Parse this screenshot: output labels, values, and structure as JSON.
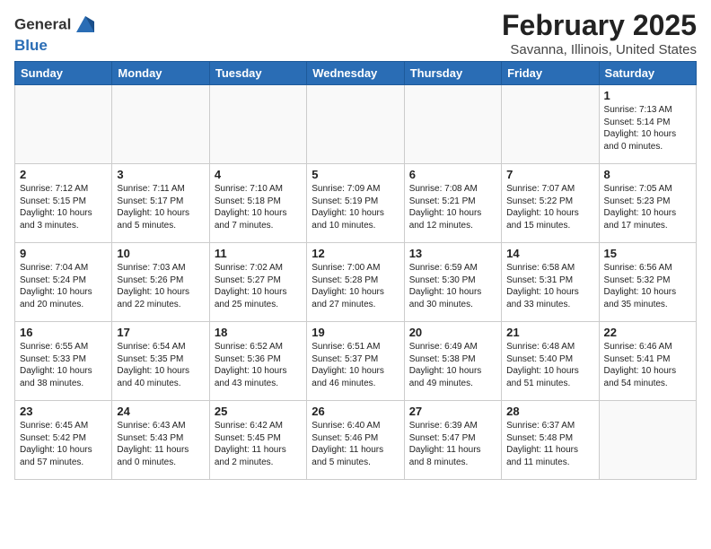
{
  "header": {
    "logo_line1": "General",
    "logo_line2": "Blue",
    "title": "February 2025",
    "subtitle": "Savanna, Illinois, United States"
  },
  "weekdays": [
    "Sunday",
    "Monday",
    "Tuesday",
    "Wednesday",
    "Thursday",
    "Friday",
    "Saturday"
  ],
  "weeks": [
    [
      {
        "day": "",
        "info": ""
      },
      {
        "day": "",
        "info": ""
      },
      {
        "day": "",
        "info": ""
      },
      {
        "day": "",
        "info": ""
      },
      {
        "day": "",
        "info": ""
      },
      {
        "day": "",
        "info": ""
      },
      {
        "day": "1",
        "info": "Sunrise: 7:13 AM\nSunset: 5:14 PM\nDaylight: 10 hours\nand 0 minutes."
      }
    ],
    [
      {
        "day": "2",
        "info": "Sunrise: 7:12 AM\nSunset: 5:15 PM\nDaylight: 10 hours\nand 3 minutes."
      },
      {
        "day": "3",
        "info": "Sunrise: 7:11 AM\nSunset: 5:17 PM\nDaylight: 10 hours\nand 5 minutes."
      },
      {
        "day": "4",
        "info": "Sunrise: 7:10 AM\nSunset: 5:18 PM\nDaylight: 10 hours\nand 7 minutes."
      },
      {
        "day": "5",
        "info": "Sunrise: 7:09 AM\nSunset: 5:19 PM\nDaylight: 10 hours\nand 10 minutes."
      },
      {
        "day": "6",
        "info": "Sunrise: 7:08 AM\nSunset: 5:21 PM\nDaylight: 10 hours\nand 12 minutes."
      },
      {
        "day": "7",
        "info": "Sunrise: 7:07 AM\nSunset: 5:22 PM\nDaylight: 10 hours\nand 15 minutes."
      },
      {
        "day": "8",
        "info": "Sunrise: 7:05 AM\nSunset: 5:23 PM\nDaylight: 10 hours\nand 17 minutes."
      }
    ],
    [
      {
        "day": "9",
        "info": "Sunrise: 7:04 AM\nSunset: 5:24 PM\nDaylight: 10 hours\nand 20 minutes."
      },
      {
        "day": "10",
        "info": "Sunrise: 7:03 AM\nSunset: 5:26 PM\nDaylight: 10 hours\nand 22 minutes."
      },
      {
        "day": "11",
        "info": "Sunrise: 7:02 AM\nSunset: 5:27 PM\nDaylight: 10 hours\nand 25 minutes."
      },
      {
        "day": "12",
        "info": "Sunrise: 7:00 AM\nSunset: 5:28 PM\nDaylight: 10 hours\nand 27 minutes."
      },
      {
        "day": "13",
        "info": "Sunrise: 6:59 AM\nSunset: 5:30 PM\nDaylight: 10 hours\nand 30 minutes."
      },
      {
        "day": "14",
        "info": "Sunrise: 6:58 AM\nSunset: 5:31 PM\nDaylight: 10 hours\nand 33 minutes."
      },
      {
        "day": "15",
        "info": "Sunrise: 6:56 AM\nSunset: 5:32 PM\nDaylight: 10 hours\nand 35 minutes."
      }
    ],
    [
      {
        "day": "16",
        "info": "Sunrise: 6:55 AM\nSunset: 5:33 PM\nDaylight: 10 hours\nand 38 minutes."
      },
      {
        "day": "17",
        "info": "Sunrise: 6:54 AM\nSunset: 5:35 PM\nDaylight: 10 hours\nand 40 minutes."
      },
      {
        "day": "18",
        "info": "Sunrise: 6:52 AM\nSunset: 5:36 PM\nDaylight: 10 hours\nand 43 minutes."
      },
      {
        "day": "19",
        "info": "Sunrise: 6:51 AM\nSunset: 5:37 PM\nDaylight: 10 hours\nand 46 minutes."
      },
      {
        "day": "20",
        "info": "Sunrise: 6:49 AM\nSunset: 5:38 PM\nDaylight: 10 hours\nand 49 minutes."
      },
      {
        "day": "21",
        "info": "Sunrise: 6:48 AM\nSunset: 5:40 PM\nDaylight: 10 hours\nand 51 minutes."
      },
      {
        "day": "22",
        "info": "Sunrise: 6:46 AM\nSunset: 5:41 PM\nDaylight: 10 hours\nand 54 minutes."
      }
    ],
    [
      {
        "day": "23",
        "info": "Sunrise: 6:45 AM\nSunset: 5:42 PM\nDaylight: 10 hours\nand 57 minutes."
      },
      {
        "day": "24",
        "info": "Sunrise: 6:43 AM\nSunset: 5:43 PM\nDaylight: 11 hours\nand 0 minutes."
      },
      {
        "day": "25",
        "info": "Sunrise: 6:42 AM\nSunset: 5:45 PM\nDaylight: 11 hours\nand 2 minutes."
      },
      {
        "day": "26",
        "info": "Sunrise: 6:40 AM\nSunset: 5:46 PM\nDaylight: 11 hours\nand 5 minutes."
      },
      {
        "day": "27",
        "info": "Sunrise: 6:39 AM\nSunset: 5:47 PM\nDaylight: 11 hours\nand 8 minutes."
      },
      {
        "day": "28",
        "info": "Sunrise: 6:37 AM\nSunset: 5:48 PM\nDaylight: 11 hours\nand 11 minutes."
      },
      {
        "day": "",
        "info": ""
      }
    ]
  ]
}
